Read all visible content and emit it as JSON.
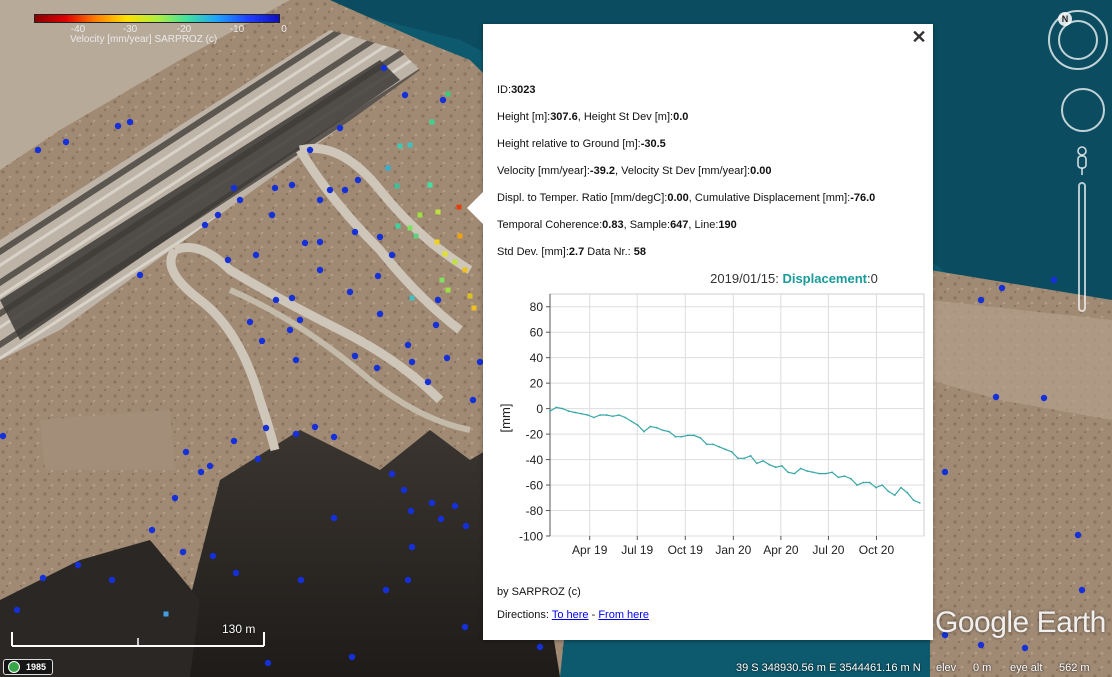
{
  "legend": {
    "ticks": [
      "-40",
      "-30",
      "-20",
      "-10",
      "0"
    ],
    "caption": "Velocity [mm/year] SARPROZ (c)"
  },
  "popup": {
    "close_label": "✕",
    "fields": [
      [
        {
          "t": "ID:"
        },
        {
          "t": "3023",
          "b": true
        }
      ],
      [
        {
          "t": "Height [m]:"
        },
        {
          "t": "307.6",
          "b": true
        },
        {
          "t": ", Height St Dev [m]:"
        },
        {
          "t": "0.0",
          "b": true
        }
      ],
      [
        {
          "t": "Height relative to Ground [m]:"
        },
        {
          "t": "-30.5",
          "b": true
        }
      ],
      [
        {
          "t": "Velocity [mm/year]:"
        },
        {
          "t": "-39.2",
          "b": true
        },
        {
          "t": ", Velocity St Dev [mm/year]:"
        },
        {
          "t": "0.00",
          "b": true
        }
      ],
      [
        {
          "t": "Displ. to Temper. Ratio [mm/degC]:"
        },
        {
          "t": "0.00",
          "b": true
        },
        {
          "t": ", Cumulative Displacement [mm]:"
        },
        {
          "t": "-76.0",
          "b": true
        }
      ],
      [
        {
          "t": "Temporal Coherence:"
        },
        {
          "t": "0.83",
          "b": true
        },
        {
          "t": ", Sample:"
        },
        {
          "t": "647",
          "b": true
        },
        {
          "t": ", Line:"
        },
        {
          "t": "190",
          "b": true
        }
      ],
      [
        {
          "t": "Std Dev. [mm]:"
        },
        {
          "t": "2.7",
          "b": true
        },
        {
          "t": " Data Nr.: "
        },
        {
          "t": "58",
          "b": true
        }
      ]
    ],
    "footer_by": "by SARPROZ (c)",
    "directions_label": "Directions: ",
    "to_here": "To here",
    "separator": " - ",
    "from_here": "From here"
  },
  "chart_data": {
    "type": "line",
    "header_date": "2019/01/15: ",
    "header_series": "Displacement",
    "header_value": ":0",
    "ylabel": "[mm]",
    "ylim": [
      -100,
      90
    ],
    "yticks": [
      80,
      60,
      40,
      20,
      0,
      -20,
      -40,
      -60,
      -80,
      -100
    ],
    "xlim": [
      "2019-01-15",
      "2020-12-31"
    ],
    "xticks": [
      {
        "label": "Apr 19",
        "date": "2019-04-01"
      },
      {
        "label": "Jul 19",
        "date": "2019-07-01"
      },
      {
        "label": "Oct 19",
        "date": "2019-10-01"
      },
      {
        "label": "Jan 20",
        "date": "2020-01-01"
      },
      {
        "label": "Apr 20",
        "date": "2020-04-01"
      },
      {
        "label": "Jul 20",
        "date": "2020-07-01"
      },
      {
        "label": "Oct 20",
        "date": "2020-10-01"
      }
    ],
    "line_color": "#3aa8a8",
    "grid": true,
    "points": [
      [
        "2019-01-15",
        -2
      ],
      [
        "2019-01-27",
        1
      ],
      [
        "2019-02-08",
        0
      ],
      [
        "2019-02-20",
        -2
      ],
      [
        "2019-03-04",
        -3
      ],
      [
        "2019-03-16",
        -4
      ],
      [
        "2019-03-28",
        -5
      ],
      [
        "2019-04-09",
        -7
      ],
      [
        "2019-04-21",
        -5
      ],
      [
        "2019-05-03",
        -5
      ],
      [
        "2019-05-15",
        -6
      ],
      [
        "2019-05-27",
        -5
      ],
      [
        "2019-06-08",
        -7
      ],
      [
        "2019-06-20",
        -10
      ],
      [
        "2019-07-02",
        -13
      ],
      [
        "2019-07-14",
        -18
      ],
      [
        "2019-07-26",
        -14
      ],
      [
        "2019-08-07",
        -15
      ],
      [
        "2019-08-19",
        -17
      ],
      [
        "2019-08-31",
        -18
      ],
      [
        "2019-09-12",
        -22
      ],
      [
        "2019-09-24",
        -22
      ],
      [
        "2019-10-06",
        -21
      ],
      [
        "2019-10-18",
        -21
      ],
      [
        "2019-10-30",
        -23
      ],
      [
        "2019-11-11",
        -28
      ],
      [
        "2019-11-23",
        -28
      ],
      [
        "2019-12-05",
        -30
      ],
      [
        "2019-12-17",
        -32
      ],
      [
        "2019-12-29",
        -34
      ],
      [
        "2020-01-10",
        -39
      ],
      [
        "2020-01-22",
        -39
      ],
      [
        "2020-02-03",
        -37
      ],
      [
        "2020-02-15",
        -43
      ],
      [
        "2020-02-27",
        -41
      ],
      [
        "2020-03-10",
        -44
      ],
      [
        "2020-03-22",
        -46
      ],
      [
        "2020-04-03",
        -45
      ],
      [
        "2020-04-15",
        -50
      ],
      [
        "2020-04-27",
        -51
      ],
      [
        "2020-05-09",
        -47
      ],
      [
        "2020-05-21",
        -49
      ],
      [
        "2020-06-02",
        -50
      ],
      [
        "2020-06-14",
        -51
      ],
      [
        "2020-06-26",
        -51
      ],
      [
        "2020-07-08",
        -50
      ],
      [
        "2020-07-20",
        -54
      ],
      [
        "2020-08-01",
        -53
      ],
      [
        "2020-08-13",
        -55
      ],
      [
        "2020-08-25",
        -60
      ],
      [
        "2020-09-06",
        -58
      ],
      [
        "2020-09-18",
        -58
      ],
      [
        "2020-09-30",
        -62
      ],
      [
        "2020-10-12",
        -60
      ],
      [
        "2020-10-24",
        -65
      ],
      [
        "2020-11-05",
        -68
      ],
      [
        "2020-11-17",
        -62
      ],
      [
        "2020-11-29",
        -66
      ],
      [
        "2020-12-11",
        -72
      ],
      [
        "2020-12-23",
        -74
      ]
    ]
  },
  "bottom": {
    "scale_label": "130 m",
    "year": "1985",
    "coords": "39 S 348930.56 m E 3544461.16 m N",
    "elev_label": "elev",
    "elev_value": "0 m",
    "eye_label": "eye alt",
    "eye_value": "562 m",
    "brand": "Google Earth"
  },
  "colors": {
    "water": "#0d5a6e",
    "terrain": "#9a8672",
    "point_blue": "#1530d8"
  }
}
